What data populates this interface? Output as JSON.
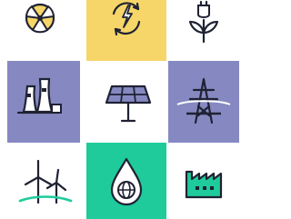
{
  "colors": {
    "white": "#ffffff",
    "yellow": "#f6d668",
    "purple": "#8689c1",
    "teal": "#1fcb9b",
    "ink": "#1f2233"
  },
  "tiles": [
    {
      "row": 0,
      "col": 0,
      "icon": "nuclear-icon",
      "bg": "white"
    },
    {
      "row": 0,
      "col": 1,
      "icon": "renewable-energy-cycle-icon",
      "bg": "yellow"
    },
    {
      "row": 0,
      "col": 2,
      "icon": "plant-energy-icon",
      "bg": "white"
    },
    {
      "row": 1,
      "col": 0,
      "icon": "cooling-towers-icon",
      "bg": "purple"
    },
    {
      "row": 1,
      "col": 1,
      "icon": "solar-panel-icon",
      "bg": "white"
    },
    {
      "row": 1,
      "col": 2,
      "icon": "power-pylon-icon",
      "bg": "purple"
    },
    {
      "row": 2,
      "col": 0,
      "icon": "wind-turbines-icon",
      "bg": "white"
    },
    {
      "row": 2,
      "col": 1,
      "icon": "oil-drop-globe-icon",
      "bg": "teal"
    },
    {
      "row": 2,
      "col": 2,
      "icon": "factory-icon",
      "bg": "white"
    }
  ]
}
